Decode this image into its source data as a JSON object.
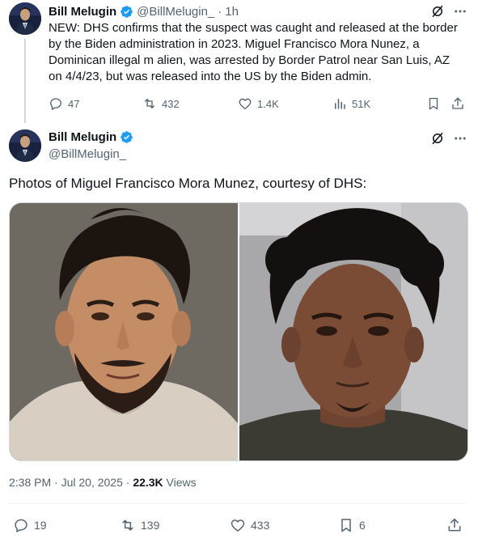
{
  "tweet1": {
    "name": "Bill Melugin",
    "handle": "@BillMelugin_",
    "separator": "·",
    "time": "1h",
    "text": "NEW: DHS confirms that the suspect was caught and released at the border by the Biden administration in 2023. Miguel Francisco Mora Nunez, a Dominican illegal m alien, was arrested by Border Patrol near San Luis, AZ on 4/4/23, but was released into the US by the Biden admin.",
    "replies": "47",
    "retweets": "432",
    "likes": "1.4K",
    "views": "51K"
  },
  "tweet2": {
    "name": "Bill Melugin",
    "handle": "@BillMelugin_",
    "text": "Photos of Miguel Francisco Mora Munez, courtesy of DHS:",
    "timestamp": "2:38 PM · Jul 20, 2025 · ",
    "views_count": "22.3K",
    "views_label": " Views",
    "replies": "19",
    "retweets": "139",
    "likes": "433",
    "bookmarks": "6"
  },
  "colors": {
    "verified": "#1d9bf0",
    "muted": "#536471",
    "text": "#0f1419"
  }
}
